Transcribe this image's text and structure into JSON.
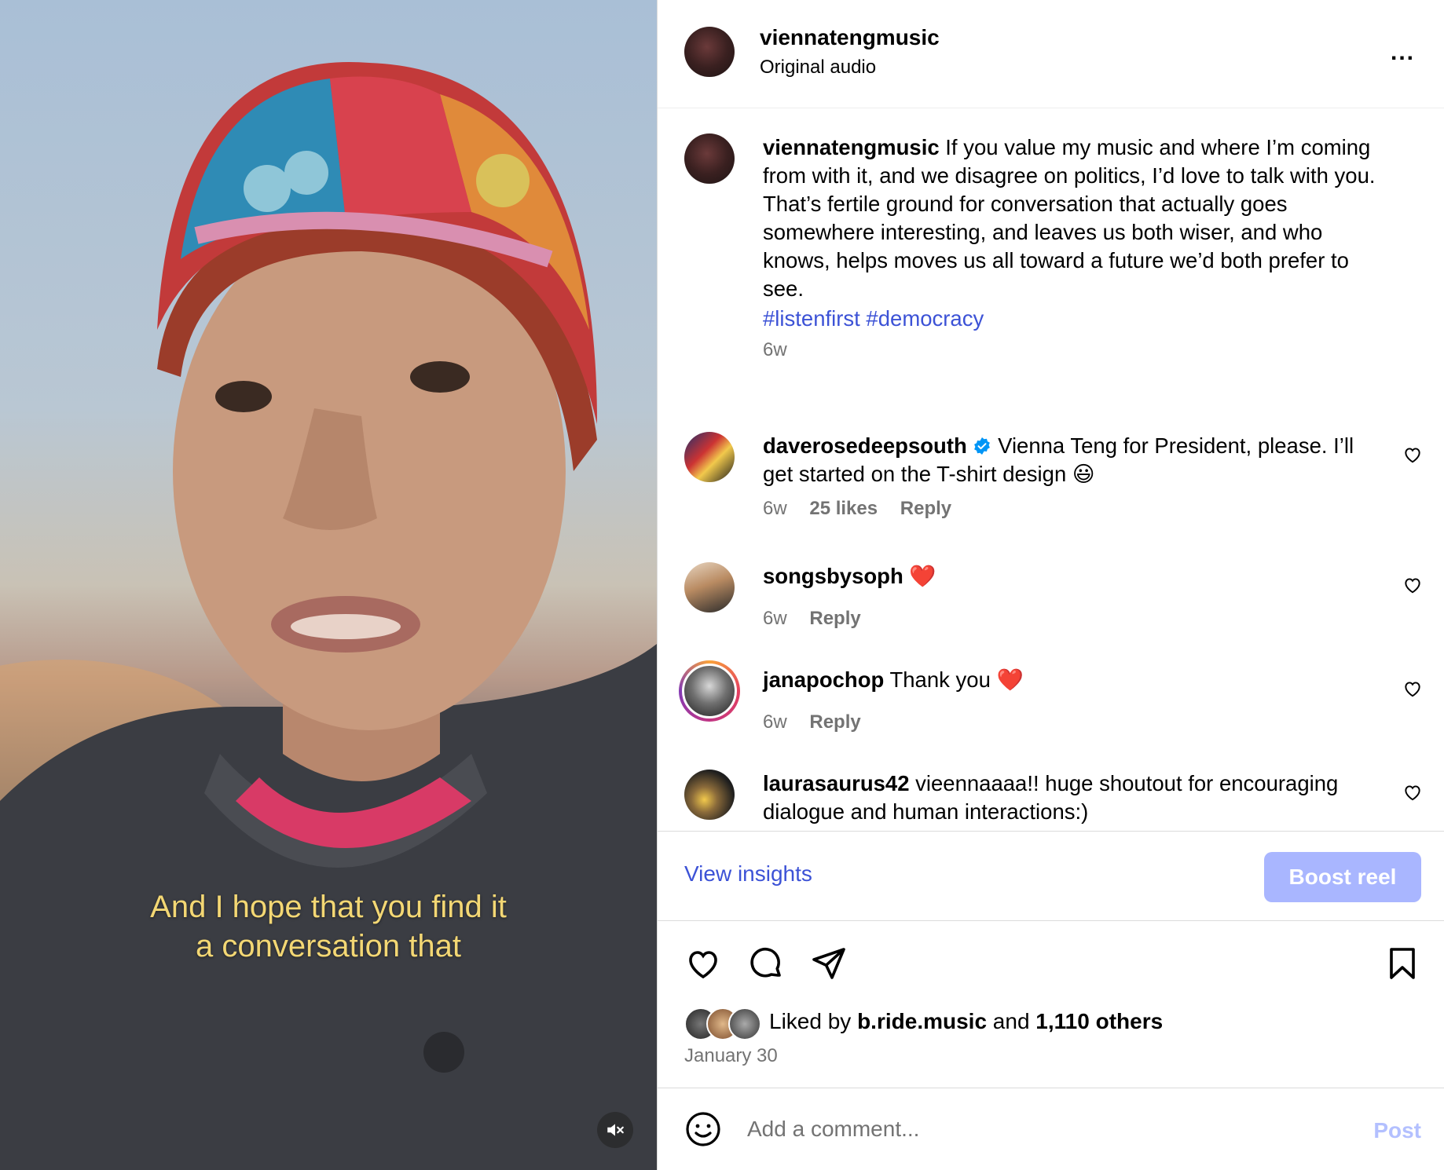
{
  "video": {
    "caption_line1": "And I hope that you find it",
    "caption_line2": "a conversation that",
    "mute_icon": "speaker-muted-icon"
  },
  "header": {
    "username": "viennatengmusic",
    "audio": "Original audio",
    "more_icon": "more-horizontal-icon",
    "more_label": "..."
  },
  "post": {
    "username": "viennatengmusic",
    "caption": "If you value my music and where I’m coming from with it, and we disagree on politics, I’d love to talk with you. That’s fertile ground for conversation that actually goes somewhere interesting, and leaves us both wiser, and who knows, helps moves us all toward a future we’d both prefer to see.",
    "hashtags": "#listenfirst #democracy",
    "time": "6w"
  },
  "comments": [
    {
      "username": "daverosedeepsouth",
      "verified": true,
      "text": " Vienna Teng for President, please. I’ll get started on the T-shirt design 😃",
      "time": "6w",
      "likes": "25 likes",
      "reply": "Reply"
    },
    {
      "username": "songsbysoph",
      "verified": false,
      "text": " ❤️",
      "time": "6w",
      "likes": "",
      "reply": "Reply"
    },
    {
      "username": "janapochop",
      "verified": false,
      "text": " Thank you ❤️",
      "time": "6w",
      "likes": "",
      "reply": "Reply"
    },
    {
      "username": "laurasaurus42",
      "verified": false,
      "text": " vieennaaaa!! huge shoutout for encouraging dialogue and human interactions:)",
      "time": "",
      "likes": "",
      "reply": ""
    }
  ],
  "insights": {
    "view_insights": "View insights",
    "boost": "Boost reel"
  },
  "actions": {
    "like_icon": "heart-icon",
    "comment_icon": "comment-icon",
    "share_icon": "send-icon",
    "save_icon": "bookmark-icon",
    "liked_by_prefix": "Liked by ",
    "liked_by_user": "b.ride.music",
    "liked_by_mid": " and ",
    "liked_by_count": "1,110 others",
    "date": "January 30"
  },
  "comment_box": {
    "emoji_icon": "emoji-icon",
    "placeholder": "Add a comment...",
    "post_label": "Post"
  },
  "colors": {
    "link_blue": "#3c52d6",
    "boost_bg": "#a9b6ff",
    "caption_yellow": "#f3d774",
    "muted_text": "#737373"
  }
}
